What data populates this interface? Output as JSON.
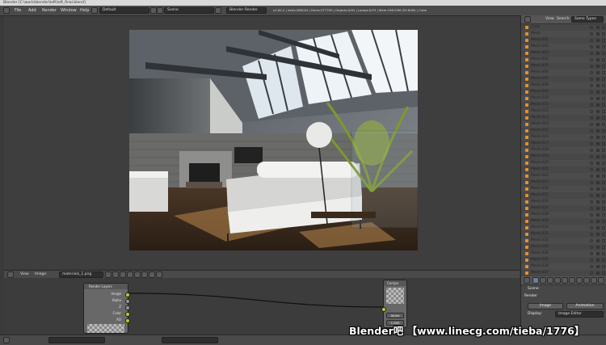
{
  "window": {
    "title": "Blender [C:\\work\\blender\\loft\\loft_final.blend]"
  },
  "info_header": {
    "menus": [
      "File",
      "Add",
      "Render",
      "Window",
      "Help"
    ],
    "screen_layout": "Default",
    "scene": "Scene",
    "render_engine": "Blender Render",
    "stats": "v2.62.0 | Verts:385024 | Faces:377700 | Objects:0/91 | Lamps:0/23 | Mem:198.53M (20.84M) | Cube"
  },
  "outliner": {
    "view_label": "View",
    "search_label": "Search",
    "filter": "Same Types",
    "items": [
      "Cube",
      "Mesh",
      "Mesh.001",
      "Mesh.002",
      "Mesh.003",
      "Mesh.004",
      "Mesh.005",
      "Mesh.006",
      "Mesh.007",
      "Mesh.008",
      "Mesh.009",
      "Mesh.010",
      "Mesh.011",
      "Mesh.012",
      "Mesh.013",
      "Mesh.014",
      "Mesh.015",
      "Mesh.016",
      "Mesh.017",
      "Mesh.018",
      "Mesh.019",
      "Mesh.020",
      "Mesh.021",
      "Mesh.022",
      "Mesh.023",
      "Mesh.024",
      "Mesh.025",
      "Mesh.026",
      "Mesh.027",
      "Mesh.028",
      "Mesh.029",
      "Mesh.030",
      "Mesh.031",
      "Mesh.032",
      "Mesh.033",
      "Mesh.034",
      "Mesh.035",
      "Mesh.036",
      "Mesh.037",
      "Mesh.038"
    ]
  },
  "node_editor": {
    "view_label": "View",
    "image_label": "Image",
    "image_name": "materials_1.png",
    "render_layers_node": {
      "title": "Render Layers",
      "outputs": [
        "Image",
        "Alpha",
        "Z",
        "Color",
        "AO"
      ]
    },
    "composite_node": {
      "title": "Compo",
      "use_alpha_label": "Alpha",
      "value": "1.000"
    }
  },
  "properties": {
    "scene_label": "Scene",
    "render_panel": "Render",
    "image_button": "Image",
    "animation_button": "Animation",
    "display_label": "Display:",
    "display_value": "Image Editor"
  },
  "watermark": "Blender吧 【www.linecg.com/tieba/1776】",
  "colors": {
    "accent": "#e8912d",
    "panel": "#474747",
    "background": "#3a3a3a",
    "socket": "#c7c729"
  }
}
